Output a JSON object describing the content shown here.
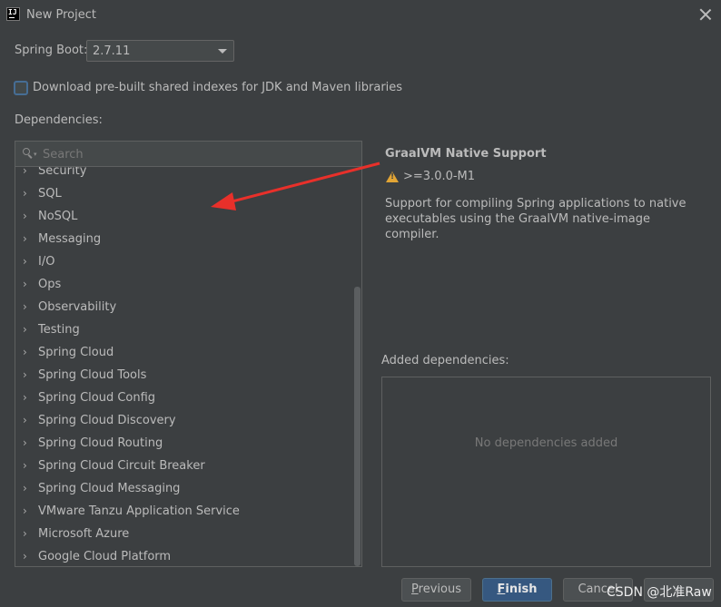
{
  "window": {
    "title": "New Project",
    "app_icon_text": "IJ"
  },
  "spring_boot": {
    "label": "Spring Boot:",
    "selected": "2.7.11"
  },
  "download_indexes": {
    "label": "Download pre-built shared indexes for JDK and Maven libraries",
    "checked": false
  },
  "dependencies": {
    "label": "Dependencies:",
    "search_placeholder": "Search",
    "categories": [
      "Security",
      "SQL",
      "NoSQL",
      "Messaging",
      "I/O",
      "Ops",
      "Observability",
      "Testing",
      "Spring Cloud",
      "Spring Cloud Tools",
      "Spring Cloud Config",
      "Spring Cloud Discovery",
      "Spring Cloud Routing",
      "Spring Cloud Circuit Breaker",
      "Spring Cloud Messaging",
      "VMware Tanzu Application Service",
      "Microsoft Azure",
      "Google Cloud Platform"
    ]
  },
  "detail": {
    "title": "GraalVM Native Support",
    "version_requirement": ">=3.0.0-M1",
    "description": "Support for compiling Spring applications to native executables using the GraalVM native-image compiler."
  },
  "added": {
    "label": "Added dependencies:",
    "empty_text": "No dependencies added"
  },
  "buttons": {
    "previous_mnemonic": "P",
    "previous_rest": "revious",
    "finish_mnemonic": "F",
    "finish_rest": "inish",
    "cancel": "Cancel",
    "help": ""
  },
  "watermark": "CSDN @北准Raw",
  "colors": {
    "annotation_arrow": "#e8302a",
    "primary_button": "#365880",
    "warning": "#e2a535"
  }
}
